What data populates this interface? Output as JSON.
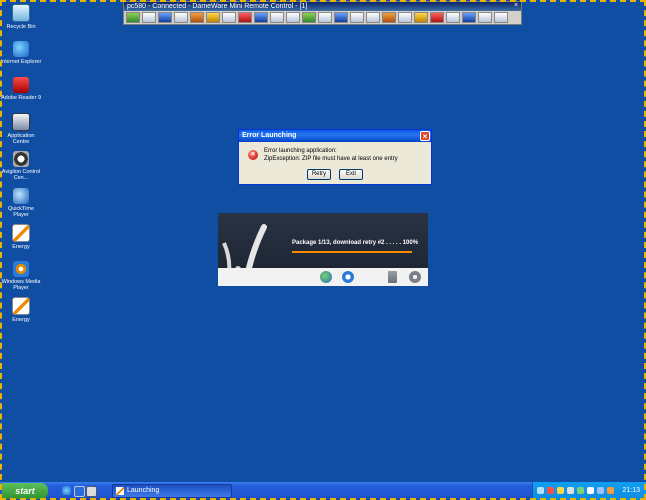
{
  "remote_window": {
    "title": "pc580 - Connected - DameWare Mini Remote Control - [1]",
    "close_glyph": "×",
    "tool_icons": [
      "exit-icon",
      "refresh-icon",
      "screenshot-icon",
      "settings-icon",
      "zoom-icon",
      "move-icon",
      "view-only-icon",
      "full-screen-icon",
      "monitor-icon",
      "clipboard-icon",
      "keyboard-icon",
      "mouse-icon",
      "chat-icon",
      "file-transfer-icon",
      "computer-icon",
      "print-icon",
      "camera-icon",
      "send-keys-icon",
      "lock-icon",
      "disconnect-icon",
      "users-icon",
      "properties-icon",
      "minimize-icon",
      "help-icon"
    ]
  },
  "desktop_icons": [
    {
      "label": "Recycle Bin",
      "icon": "recycle-bin-icon"
    },
    {
      "label": "Internet Explorer",
      "icon": "internet-explorer-icon"
    },
    {
      "label": "Adobe Reader 9",
      "icon": "adobe-reader-icon"
    },
    {
      "label": "Application Centre",
      "icon": "application-centre-icon"
    },
    {
      "label": "Avigilon Control Cen...",
      "icon": "avigilon-icon"
    },
    {
      "label": "QuickTime Player",
      "icon": "quicktime-icon"
    },
    {
      "label": "Energy",
      "icon": "energy-icon"
    },
    {
      "label": "Windows Media Player",
      "icon": "windows-media-player-icon"
    },
    {
      "label": "Energy",
      "icon": "energy-icon"
    }
  ],
  "error_dialog": {
    "title": "Error Launching",
    "close_glyph": "×",
    "message_line1": "Error launching application:",
    "message_line2": "ZipException: ZIP file must have at least one entry",
    "retry_label": "Retry",
    "exit_label": "Exit",
    "error_glyph": "×"
  },
  "launcher_splash": {
    "status": "Package 1/13, download retry #2 . . . . . 100%",
    "progress_percent": 100,
    "bottom_icons": [
      "globe-icon",
      "java-icon",
      "document-icon",
      "gear-icon"
    ]
  },
  "taskbar": {
    "start_label": "start",
    "task_label": "Launching",
    "clock": "21:13",
    "colors": {
      "start": "#3c9b3c",
      "bar": "#245edb",
      "tray": "#0f9ff4"
    }
  }
}
